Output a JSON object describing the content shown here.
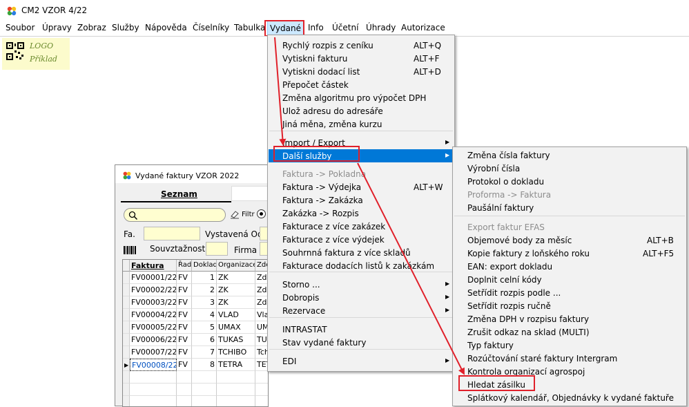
{
  "app": {
    "title": "CM2 VZOR 4/22"
  },
  "menubar": {
    "items": [
      "Soubor",
      "Úpravy",
      "Zobraz",
      "Služby",
      "Nápověda",
      "Číselníky",
      "Tabulka",
      "Vydané",
      "Info",
      "Účetní",
      "Úhrady",
      "Autorizace"
    ]
  },
  "logo": {
    "line1": "LOGO",
    "line2": "Příklad"
  },
  "window": {
    "title": "Vydané faktury VZOR  2022",
    "tab_seznam": "Seznam",
    "filter_label": "Filtr",
    "fa_label": "Fa.",
    "vystavena_label": "Vystavená Od",
    "souvztaznost_label": "Souvztažnost",
    "firma_label": "Firma",
    "columns": [
      "Faktura",
      "Řada",
      "Doklad",
      "Organizace",
      "Zde"
    ],
    "rows": [
      {
        "faktura": "FV00001/22",
        "rada": "FV",
        "doklad": "1",
        "org": "ZK",
        "extra": "Zde"
      },
      {
        "faktura": "FV00002/22",
        "rada": "FV",
        "doklad": "2",
        "org": "ZK",
        "extra": "Zde"
      },
      {
        "faktura": "FV00003/22",
        "rada": "FV",
        "doklad": "3",
        "org": "ZK",
        "extra": "Zde"
      },
      {
        "faktura": "FV00004/22",
        "rada": "FV",
        "doklad": "4",
        "org": "VLAD",
        "extra": "Vla"
      },
      {
        "faktura": "FV00005/22",
        "rada": "FV",
        "doklad": "5",
        "org": "UMAX",
        "extra": "UMA"
      },
      {
        "faktura": "FV00006/22",
        "rada": "FV",
        "doklad": "6",
        "org": "TUKAS",
        "extra": "TUK"
      },
      {
        "faktura": "FV00007/22",
        "rada": "FV",
        "doklad": "7",
        "org": "TCHIBO",
        "extra": "Tch"
      },
      {
        "faktura": "FV00008/22",
        "rada": "FV",
        "doklad": "8",
        "org": "TETRA",
        "extra": "TET"
      }
    ]
  },
  "vydane_menu": {
    "items": [
      {
        "label": "Rychlý rozpis z ceníku",
        "shortcut": "ALT+Q"
      },
      {
        "label": "Vytiskni fakturu",
        "shortcut": "ALT+F"
      },
      {
        "label": "Vytiskni dodací list",
        "shortcut": "ALT+D"
      },
      {
        "label": "Přepočet  částek",
        "shortcut": ""
      },
      {
        "label": "Změna algoritmu pro výpočet DPH",
        "shortcut": ""
      },
      {
        "label": "Ulož adresu do adresáře",
        "shortcut": ""
      },
      {
        "label": "Jiná měna, změna kurzu",
        "shortcut": ""
      },
      {
        "label": "Import / Export",
        "shortcut": ""
      },
      {
        "label": "Další služby",
        "shortcut": ""
      },
      {
        "label": "Faktura -> Pokladna",
        "shortcut": ""
      },
      {
        "label": "Faktura -> Výdejka",
        "shortcut": "ALT+W"
      },
      {
        "label": "Faktura -> Zakázka",
        "shortcut": ""
      },
      {
        "label": "Zakázka -> Rozpis",
        "shortcut": ""
      },
      {
        "label": "Fakturace z více zakázek",
        "shortcut": ""
      },
      {
        "label": "Fakturace z více výdejek",
        "shortcut": ""
      },
      {
        "label": "Souhrnná faktura z více skladů",
        "shortcut": ""
      },
      {
        "label": "Fakturace dodacích listů k zakázkám",
        "shortcut": ""
      },
      {
        "label": "Storno ...",
        "shortcut": ""
      },
      {
        "label": "Dobropis",
        "shortcut": ""
      },
      {
        "label": "Rezervace",
        "shortcut": ""
      },
      {
        "label": "INTRASTAT",
        "shortcut": ""
      },
      {
        "label": "Stav vydané faktury",
        "shortcut": ""
      },
      {
        "label": "EDI",
        "shortcut": ""
      }
    ]
  },
  "dalsi_menu": {
    "items": [
      {
        "label": "Změna čísla faktury",
        "shortcut": ""
      },
      {
        "label": "Výrobní čísla",
        "shortcut": ""
      },
      {
        "label": "Protokol o dokladu",
        "shortcut": ""
      },
      {
        "label": "Proforma -> Faktura",
        "shortcut": ""
      },
      {
        "label": "Paušální faktury",
        "shortcut": ""
      },
      {
        "label": "Export faktur EFAS",
        "shortcut": ""
      },
      {
        "label": "Objemové body za měsíc",
        "shortcut": "ALT+B"
      },
      {
        "label": "Kopie faktury z loňského roku",
        "shortcut": "ALT+F5"
      },
      {
        "label": "EAN: export dokladu",
        "shortcut": ""
      },
      {
        "label": "Doplnit celní kódy",
        "shortcut": ""
      },
      {
        "label": "Setřídit rozpis podle ...",
        "shortcut": ""
      },
      {
        "label": "Setřídit rozpis ručně",
        "shortcut": ""
      },
      {
        "label": "Změna DPH v rozpisu faktury",
        "shortcut": ""
      },
      {
        "label": "Zrušit odkaz na sklad (MULTI)",
        "shortcut": ""
      },
      {
        "label": "Typ faktury",
        "shortcut": ""
      },
      {
        "label": "Rozúčtování staré faktury Intergram",
        "shortcut": ""
      },
      {
        "label": "Kontrola organizací agrospoj",
        "shortcut": ""
      },
      {
        "label": "Hledat zásilku",
        "shortcut": ""
      },
      {
        "label": "Splátkový kalendář, Objednávky k vydané faktuře",
        "shortcut": ""
      }
    ]
  },
  "colors": {
    "highlight": "#0078d7",
    "annotation": "#e0202a",
    "menu_bg": "#f2f2f2"
  }
}
